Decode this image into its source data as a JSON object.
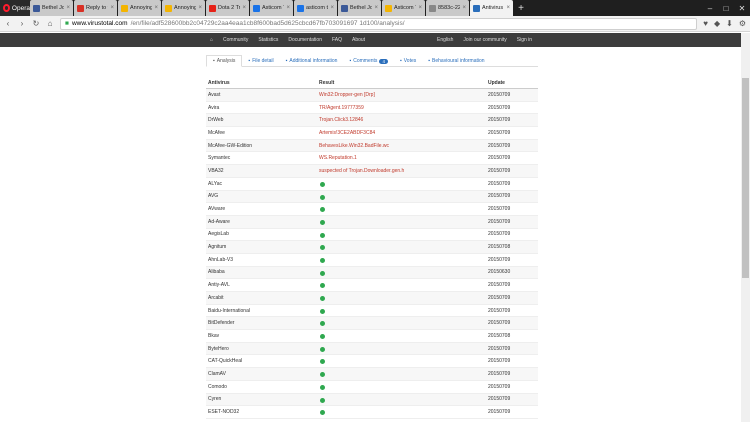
{
  "browser": {
    "opera_label": "Opera",
    "tabs": [
      {
        "label": "Bethel Joy",
        "color": "#3b5998",
        "active": false
      },
      {
        "label": "Reply to th",
        "color": "#d93025",
        "active": false
      },
      {
        "label": "Annoying a",
        "color": "#f4b400",
        "active": false
      },
      {
        "label": "Annoying a",
        "color": "#f4b400",
        "active": false
      },
      {
        "label": "Dota 2 Tr",
        "color": "#e62117",
        "active": false
      },
      {
        "label": "Asticom Te",
        "color": "#1a73e8",
        "active": false
      },
      {
        "label": "asticom te",
        "color": "#1a73e8",
        "active": false
      },
      {
        "label": "Bethel Joy",
        "color": "#3b5998",
        "active": false
      },
      {
        "label": "Asticom Te",
        "color": "#f4b400",
        "active": false
      },
      {
        "label": "8583c-22",
        "color": "#888888",
        "active": false
      },
      {
        "label": "Antivirus sc",
        "color": "#2a6ebb",
        "active": true
      }
    ],
    "url_domain": "www.virustotal.com",
    "url_path": "/en/file/adf528600bb2c04729c2aa4eaa1cb8f600bad5d625cbcd67fb703091697 1d100/analysis/"
  },
  "site_nav": {
    "left": [
      "Community",
      "Statistics",
      "Documentation",
      "FAQ",
      "About"
    ],
    "right": [
      "English",
      "Join our community",
      "Sign in"
    ]
  },
  "content_tabs": [
    {
      "label": "Analysis",
      "active": true
    },
    {
      "label": "File detail",
      "active": false
    },
    {
      "label": "Additional information",
      "active": false
    },
    {
      "label": "Comments",
      "active": false,
      "badge": "4"
    },
    {
      "label": "Votes",
      "active": false
    },
    {
      "label": "Behavioural information",
      "active": false
    }
  ],
  "table": {
    "headers": [
      "Antivirus",
      "Result",
      "Update"
    ],
    "rows": [
      {
        "av": "Avast",
        "result": "Win32:Dropper-gen [Drp]",
        "update": "20150709"
      },
      {
        "av": "Avira",
        "result": "TR/Agent.19777359",
        "update": "20150709"
      },
      {
        "av": "DrWeb",
        "result": "Trojan.Click3.12846",
        "update": "20150709"
      },
      {
        "av": "McAfee",
        "result": "Artemis!3CE2ABDF3C84",
        "update": "20150709"
      },
      {
        "av": "McAfee-GW-Edition",
        "result": "BehavesLike.Win32.BadFile.wc",
        "update": "20150709"
      },
      {
        "av": "Symantec",
        "result": "WS.Reputation.1",
        "update": "20150709"
      },
      {
        "av": "VBA32",
        "result": "suspected of Trojan.Downloader.gen.h",
        "update": "20150709"
      },
      {
        "av": "ALYac",
        "result": "",
        "update": "20150709"
      },
      {
        "av": "AVG",
        "result": "",
        "update": "20150709"
      },
      {
        "av": "AVware",
        "result": "",
        "update": "20150709"
      },
      {
        "av": "Ad-Aware",
        "result": "",
        "update": "20150709"
      },
      {
        "av": "AegisLab",
        "result": "",
        "update": "20150709"
      },
      {
        "av": "Agnitum",
        "result": "",
        "update": "20150708"
      },
      {
        "av": "AhnLab-V3",
        "result": "",
        "update": "20150709"
      },
      {
        "av": "Alibaba",
        "result": "",
        "update": "20150630"
      },
      {
        "av": "Antiy-AVL",
        "result": "",
        "update": "20150709"
      },
      {
        "av": "Arcabit",
        "result": "",
        "update": "20150709"
      },
      {
        "av": "Baidu-International",
        "result": "",
        "update": "20150709"
      },
      {
        "av": "BitDefender",
        "result": "",
        "update": "20150709"
      },
      {
        "av": "Bkav",
        "result": "",
        "update": "20150708"
      },
      {
        "av": "ByteHero",
        "result": "",
        "update": "20150709"
      },
      {
        "av": "CAT-QuickHeal",
        "result": "",
        "update": "20150709"
      },
      {
        "av": "ClamAV",
        "result": "",
        "update": "20150709"
      },
      {
        "av": "Comodo",
        "result": "",
        "update": "20150709"
      },
      {
        "av": "Cyren",
        "result": "",
        "update": "20150709"
      },
      {
        "av": "ESET-NOD32",
        "result": "",
        "update": "20150709"
      }
    ]
  }
}
